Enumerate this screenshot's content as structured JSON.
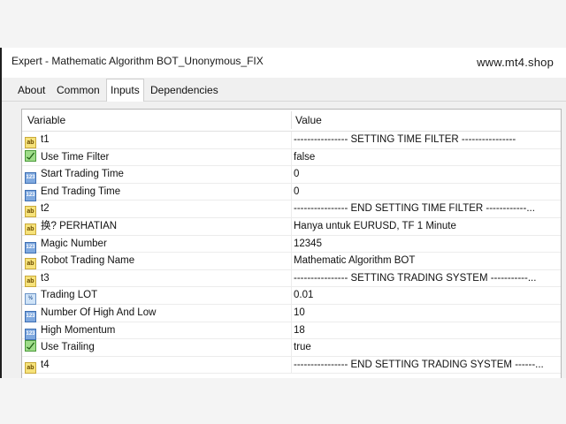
{
  "window": {
    "title": "Expert - Mathematic Algorithm BOT_Unonymous_FIX",
    "site": "www.mt4.shop"
  },
  "tabs": [
    {
      "label": "About",
      "active": false
    },
    {
      "label": "Common",
      "active": false
    },
    {
      "label": "Inputs",
      "active": true
    },
    {
      "label": "Dependencies",
      "active": false
    }
  ],
  "table": {
    "headers": {
      "variable": "Variable",
      "value": "Value"
    },
    "rows": [
      {
        "icon": "string",
        "variable": "t1",
        "value": "---------------- SETTING TIME FILTER ----------------"
      },
      {
        "icon": "bool",
        "variable": "Use Time Filter",
        "value": "false"
      },
      {
        "icon": "int",
        "variable": "Start Trading Time",
        "value": "0"
      },
      {
        "icon": "int",
        "variable": "End Trading Time",
        "value": "0"
      },
      {
        "icon": "string",
        "variable": "t2",
        "value": "---------------- END SETTING TIME FILTER ------------..."
      },
      {
        "icon": "string",
        "variable": "换? PERHATIAN",
        "value": "Hanya untuk EURUSD, TF 1 Minute"
      },
      {
        "icon": "int",
        "variable": "Magic Number",
        "value": "12345"
      },
      {
        "icon": "string",
        "variable": "Robot Trading Name",
        "value": "Mathematic Algorithm BOT"
      },
      {
        "icon": "string",
        "variable": "t3",
        "value": "---------------- SETTING TRADING SYSTEM -----------..."
      },
      {
        "icon": "double",
        "variable": "Trading LOT",
        "value": "0.01"
      },
      {
        "icon": "int",
        "variable": "Number Of High And Low",
        "value": "10"
      },
      {
        "icon": "int",
        "variable": "High Momentum",
        "value": "18"
      },
      {
        "icon": "bool",
        "variable": "Use Trailing",
        "value": "true"
      },
      {
        "icon": "string",
        "variable": "t4",
        "value": "---------------- END SETTING TRADING SYSTEM ------..."
      }
    ]
  },
  "icon_labels": {
    "string": "ab",
    "int": "123",
    "double": "½",
    "bool": ""
  },
  "colors": {
    "string_icon": "#f6e27a",
    "int_icon": "#7fa9df",
    "bool_icon": "#9fdc8a"
  }
}
